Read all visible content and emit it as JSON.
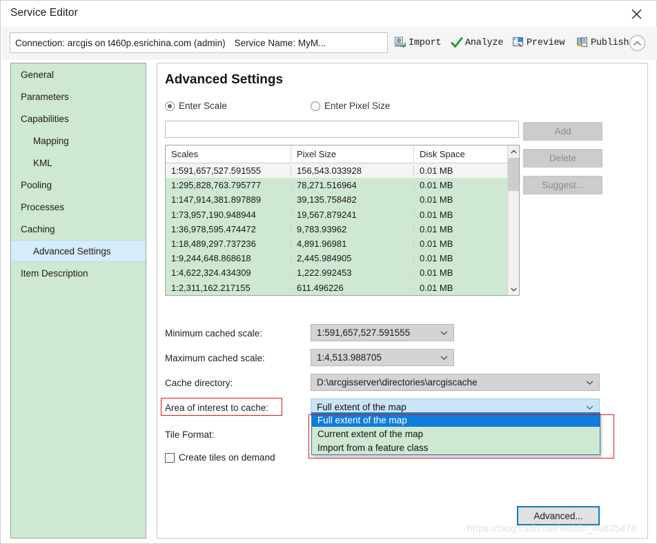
{
  "window": {
    "title": "Service Editor",
    "close_icon": "close-icon"
  },
  "toolstrip": {
    "connection_text": "Connection: arcgis on t460p.esrichina.com (admin)",
    "service_name_text": "Service Name: MyM...",
    "buttons": [
      {
        "label": "Import",
        "icon": "import-icon"
      },
      {
        "label": "Analyze",
        "icon": "checkmark-icon"
      },
      {
        "label": "Preview",
        "icon": "preview-icon"
      },
      {
        "label": "Publish",
        "icon": "publish-icon"
      }
    ],
    "collapse_icon": "chevron-up-circle-icon"
  },
  "sidebar": {
    "items": [
      {
        "label": "General",
        "indent": false,
        "active": false
      },
      {
        "label": "Parameters",
        "indent": false,
        "active": false
      },
      {
        "label": "Capabilities",
        "indent": false,
        "active": false
      },
      {
        "label": "Mapping",
        "indent": true,
        "active": false
      },
      {
        "label": "KML",
        "indent": true,
        "active": false
      },
      {
        "label": "Pooling",
        "indent": false,
        "active": false
      },
      {
        "label": "Processes",
        "indent": false,
        "active": false
      },
      {
        "label": "Caching",
        "indent": false,
        "active": false
      },
      {
        "label": "Advanced Settings",
        "indent": true,
        "active": true
      },
      {
        "label": "Item Description",
        "indent": false,
        "active": false
      }
    ]
  },
  "content": {
    "heading": "Advanced Settings",
    "radios": [
      {
        "label": "Enter Scale",
        "checked": true
      },
      {
        "label": "Enter Pixel Size",
        "checked": false
      }
    ],
    "scale_input": {
      "value": "",
      "placeholder": ""
    },
    "side_buttons": [
      {
        "label": "Add",
        "disabled": true
      },
      {
        "label": "Delete",
        "disabled": true
      },
      {
        "label": "Suggest...",
        "disabled": true
      }
    ],
    "table": {
      "columns": [
        "Scales",
        "Pixel Size",
        "Disk Space"
      ],
      "rows": [
        [
          "1:591,657,527.591555",
          "156,543.033928",
          "0.01 MB"
        ],
        [
          "1:295,828,763.795777",
          "78,271.516964",
          "0.01 MB"
        ],
        [
          "1:147,914,381.897889",
          "39,135.758482",
          "0.01 MB"
        ],
        [
          "1:73,957,190.948944",
          "19,567.879241",
          "0.01 MB"
        ],
        [
          "1:36,978,595.474472",
          "9,783.93962",
          "0.01 MB"
        ],
        [
          "1:18,489,297.737236",
          "4,891.96981",
          "0.01 MB"
        ],
        [
          "1:9,244,648.868618",
          "2,445.984905",
          "0.01 MB"
        ],
        [
          "1:4,622,324.434309",
          "1,222.992453",
          "0.01 MB"
        ],
        [
          "1:2,311,162.217155",
          "611.496226",
          "0.01 MB"
        ]
      ]
    },
    "fields": {
      "min_cached_scale_label": "Minimum cached scale:",
      "min_cached_scale_value": "1:591,657,527.591555",
      "max_cached_scale_label": "Maximum cached scale:",
      "max_cached_scale_value": "1:4,513.988705",
      "cache_directory_label": "Cache directory:",
      "cache_directory_value": "D:\\arcgisserver\\directories\\arcgiscache",
      "area_of_interest_label": "Area of interest to cache:",
      "area_of_interest_value": "Full extent of the map",
      "tile_format_label": "Tile Format:",
      "create_tiles_label": "Create tiles on demand",
      "create_tiles_checked": false
    },
    "dropdown_options": [
      {
        "label": "Full extent of the map",
        "selected": true
      },
      {
        "label": "Current extent of the map",
        "selected": false
      },
      {
        "label": "Import from a feature class",
        "selected": false
      }
    ],
    "advanced_button_label": "Advanced..."
  },
  "watermark": "https://blog.csdn.net/weixin_40625478",
  "colors": {
    "sidebar_green": "#cfe8d1",
    "table_green": "#cfe8d1",
    "active_nav_blue": "#d6ebfb",
    "dropdown_selected_blue": "#0f7ddb",
    "combo_light_blue": "#cce4f7",
    "highlight_red": "#e01717",
    "focus_blue": "#0d7ac4"
  }
}
